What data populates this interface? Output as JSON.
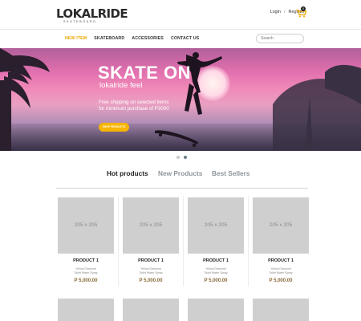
{
  "brand": {
    "logo": "LOKALRIDE",
    "tagline": "SKATEBOARD"
  },
  "header": {
    "login": "Login",
    "separator": "/",
    "register": "Register",
    "cart_count": "0"
  },
  "nav": {
    "items": [
      "NEW ITEM",
      "SKATEBOARD",
      "ACCESSORIES",
      "CONTACT US"
    ],
    "active_index": 0,
    "search_placeholder": "Search"
  },
  "hero": {
    "title": "SKATE ON",
    "subtitle": "lokalride feel",
    "promo_line1": "Free shipping on selected items",
    "promo_line2": "for minimum purchase of P3000",
    "button": "SHOP PRODUCTS"
  },
  "carousel": {
    "slide_count": 2,
    "active_slide": 2
  },
  "tabs": {
    "items": [
      "Hot products",
      "New Products",
      "Best Sellers"
    ],
    "active_index": 0
  },
  "products": [
    {
      "image_label": "205 x 205",
      "name": "PRODUCT 1",
      "desc_line1": "Yellow Diamond",
      "desc_line2": "Toilet Water Spray",
      "price": "P 5,000.00"
    },
    {
      "image_label": "205 x 205",
      "name": "PRODUCT 1",
      "desc_line1": "Yellow Diamond",
      "desc_line2": "Toilet Water Spray",
      "price": "P 5,000.00"
    },
    {
      "image_label": "205 x 205",
      "name": "PRODUCT 1",
      "desc_line1": "Yellow Diamond",
      "desc_line2": "Toilet Water Spray",
      "price": "P 5,000.00"
    },
    {
      "image_label": "205 x 205",
      "name": "PRODUCT 1",
      "desc_line1": "Yellow Diamond",
      "desc_line2": "Toilet Water Spray",
      "price": "P 5,000.00"
    }
  ],
  "colors": {
    "accent": "#f7b500",
    "nav_active": "#e8a800",
    "price": "#8a6a3a"
  },
  "icons": {
    "cart": "cart-icon"
  }
}
